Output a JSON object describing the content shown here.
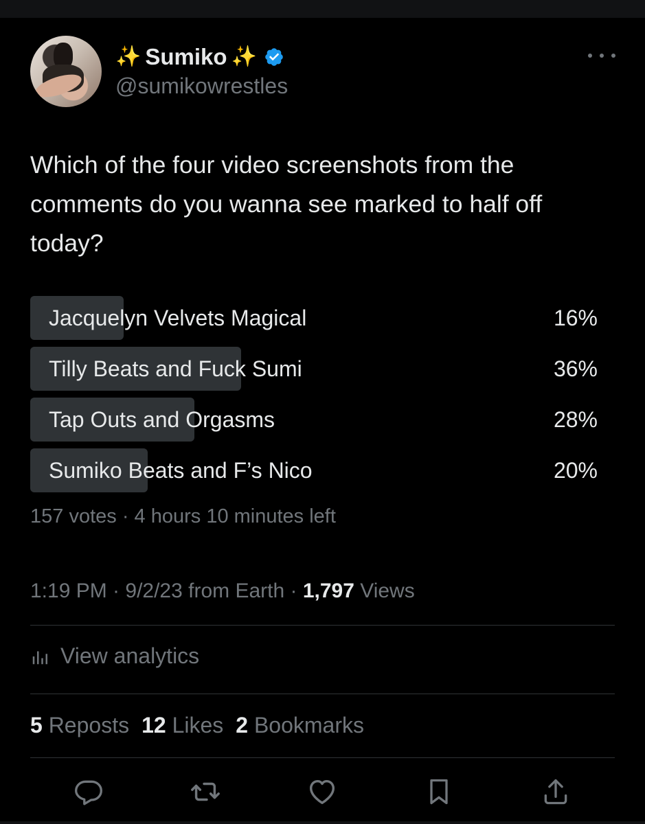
{
  "user": {
    "sparkle_left": "✨",
    "display_name": "Sumiko",
    "sparkle_right": "✨",
    "handle": "@sumikowrestles",
    "verified": true
  },
  "tweet": {
    "text": "Which of the four video screenshots from the comments do you wanna see marked to half off today?"
  },
  "poll": {
    "options": [
      {
        "label": "Jacquelyn Velvets Magical",
        "percent_text": "16%",
        "percent": 16
      },
      {
        "label": "Tilly Beats and Fuck Sumi",
        "percent_text": "36%",
        "percent": 36
      },
      {
        "label": "Tap Outs and Orgasms",
        "percent_text": "28%",
        "percent": 28
      },
      {
        "label": "Sumiko Beats and F’s Nico",
        "percent_text": "20%",
        "percent": 20
      }
    ],
    "meta": "157 votes · 4 hours 10 minutes left"
  },
  "timestamp": {
    "text": "1:19 PM · 9/2/23 from Earth · ",
    "views_count": "1,797",
    "views_label": " Views"
  },
  "analytics": {
    "label": "View analytics"
  },
  "stats": {
    "reposts_count": "5",
    "reposts_label": " Reposts",
    "likes_count": "12",
    "likes_label": " Likes",
    "bookmarks_count": "2",
    "bookmarks_label": " Bookmarks"
  },
  "icons": {
    "reply": "reply-icon",
    "repost": "repost-icon",
    "like": "heart-icon",
    "bookmark": "bookmark-icon",
    "share": "share-icon",
    "verified": "verified-badge-icon",
    "more": "more-icon",
    "analytics": "analytics-icon"
  },
  "colors": {
    "background": "#000000",
    "text": "#e7e9ea",
    "secondary": "#71767b",
    "poll_fill": "#2f3336",
    "verified": "#1d9bf0",
    "sparkle": "#f4c338"
  }
}
